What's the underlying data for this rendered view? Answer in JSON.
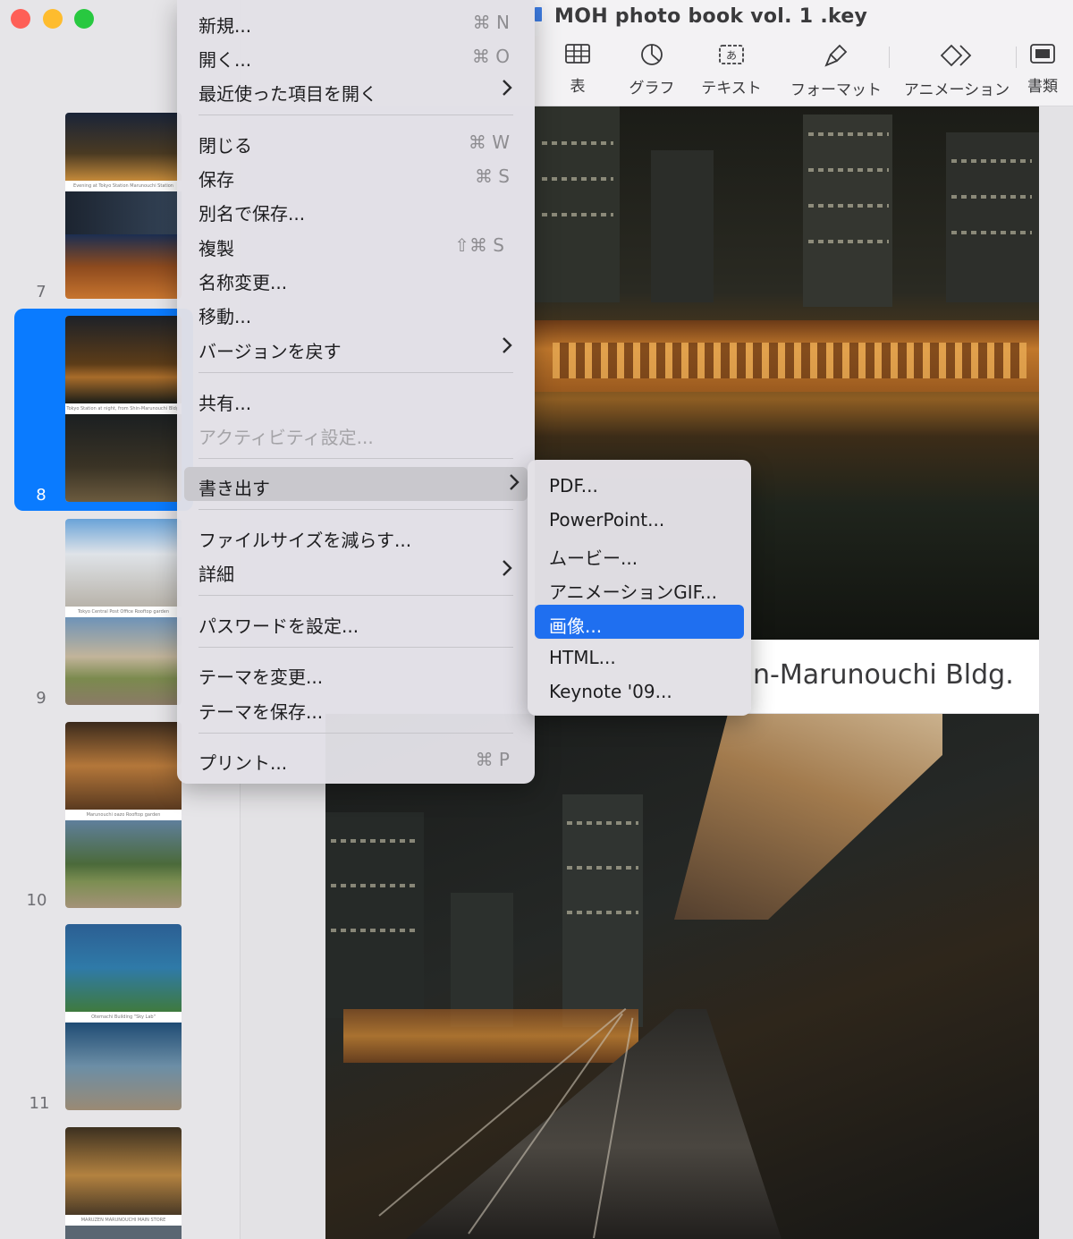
{
  "window": {
    "title": "MOH photo book vol. 1 .key"
  },
  "toolbar": {
    "items": [
      {
        "label": "表",
        "icon": "table-icon"
      },
      {
        "label": "グラフ",
        "icon": "chart-icon"
      },
      {
        "label": "テキスト",
        "icon": "text-box-icon"
      },
      {
        "label": "フォーマット",
        "icon": "format-brush-icon"
      },
      {
        "label": "アニメーション",
        "icon": "animation-diamond-icon"
      },
      {
        "label": "書類",
        "icon": "document-panel-icon"
      }
    ]
  },
  "slides": {
    "numbers": [
      "7",
      "8",
      "9",
      "10",
      "11"
    ],
    "selected": "8",
    "captions": [
      "Evening at Tokyo Station Marunouchi Station Square",
      "Tokyo Station at night, from Shin-Marunouchi Bldg.",
      "Tokyo Central Post Office Rooftop garden",
      "Marunouchi oazo Rooftop garden",
      "Otemachi Building \"Sky Lab\"",
      "MARUZEN MARUNOUCHI MAIN STORE"
    ]
  },
  "main_slide": {
    "caption": "n-Marunouchi Bldg."
  },
  "file_menu": {
    "items": [
      {
        "label": "新規...",
        "shortcut": "⌘ N"
      },
      {
        "label": "開く...",
        "shortcut": "⌘ O"
      },
      {
        "label": "最近使った項目を開く",
        "submenu": true
      },
      {
        "label": "閉じる",
        "shortcut": "⌘ W"
      },
      {
        "label": "保存",
        "shortcut": "⌘ S"
      },
      {
        "label": "別名で保存..."
      },
      {
        "label": "複製",
        "shortcut": "⇧⌘ S"
      },
      {
        "label": "名称変更..."
      },
      {
        "label": "移動..."
      },
      {
        "label": "バージョンを戻す",
        "submenu": true
      },
      {
        "label": "共有..."
      },
      {
        "label": "アクティビティ設定...",
        "disabled": true
      },
      {
        "label": "書き出す",
        "submenu": true,
        "highlighted": true
      },
      {
        "label": "ファイルサイズを減らす..."
      },
      {
        "label": "詳細",
        "submenu": true
      },
      {
        "label": "パスワードを設定..."
      },
      {
        "label": "テーマを変更..."
      },
      {
        "label": "テーマを保存..."
      },
      {
        "label": "プリント...",
        "shortcut": "⌘ P"
      }
    ]
  },
  "export_submenu": {
    "items": [
      {
        "label": "PDF..."
      },
      {
        "label": "PowerPoint..."
      },
      {
        "label": "ムービー..."
      },
      {
        "label": "アニメーションGIF..."
      },
      {
        "label": "画像...",
        "active": true
      },
      {
        "label": "HTML..."
      },
      {
        "label": "Keynote '09..."
      }
    ]
  },
  "colors": {
    "selection_blue": "#0a7bff",
    "menu_active_blue": "#1f6ff0"
  }
}
